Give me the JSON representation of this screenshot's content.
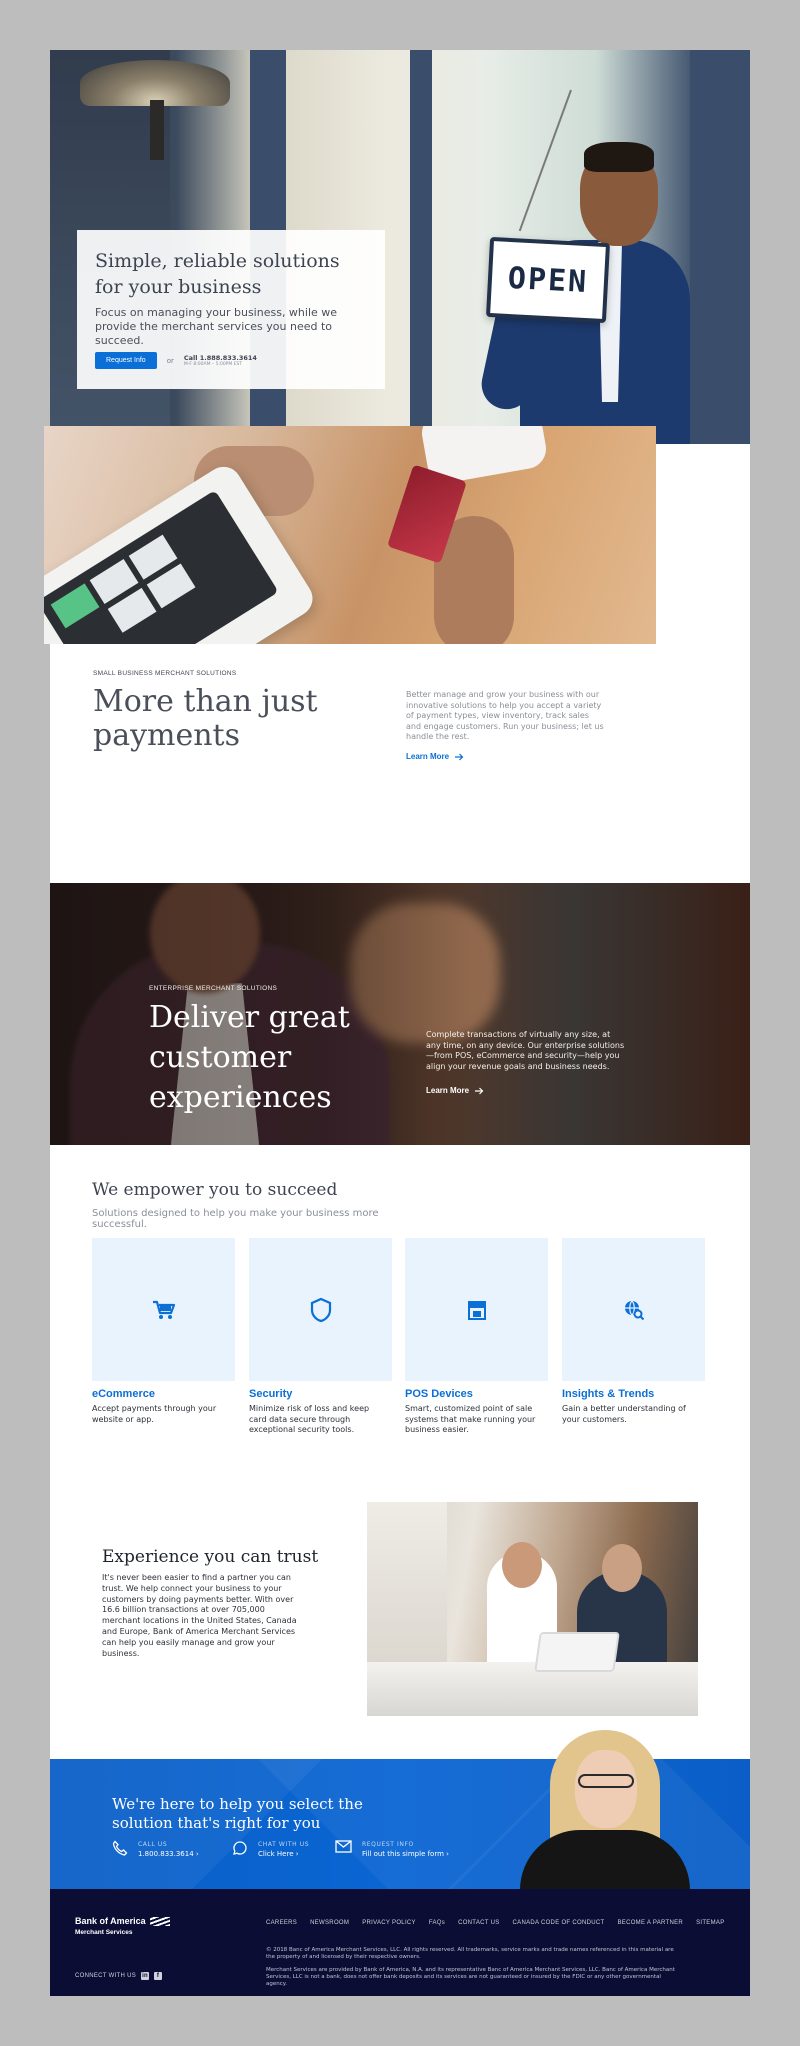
{
  "hero": {
    "title": "Simple, reliable solutions for your business",
    "text": "Focus on managing your business, while we provide the merchant services you need to succeed.",
    "button": "Request Info",
    "or": "or",
    "call": "Call 1.888.833.3614",
    "hours": "M-F 8:00AM – 5:00PM EST",
    "sign": "OPEN"
  },
  "payments": {
    "eyebrow": "SMALL BUSINESS MERCHANT SOLUTIONS",
    "title": "More than just payments",
    "text": "Better manage and grow your business with our innovative solutions to help you accept a variety of payment types, view inventory, track sales and engage customers. Run your business; let us handle the rest.",
    "link": "Learn More"
  },
  "enterprise": {
    "eyebrow": "ENTERPRISE MERCHANT SOLUTIONS",
    "title": "Deliver great customer experiences",
    "text": "Complete transactions of virtually any size, at any time, on any device. Our enterprise solutions—from POS, eCommerce and security—help you align your revenue goals and business needs.",
    "link": "Learn More"
  },
  "empower": {
    "title": "We empower you to succeed",
    "subtitle": "Solutions designed to help you make your business more successful.",
    "items": [
      {
        "title": "eCommerce",
        "text": "Accept payments through your website or app.",
        "icon": "cart-icon"
      },
      {
        "title": "Security",
        "text": "Minimize risk of loss and keep card data secure through exceptional security tools.",
        "icon": "shield-icon"
      },
      {
        "title": "POS Devices",
        "text": "Smart, customized point of sale systems that make running your business easier.",
        "icon": "store-icon"
      },
      {
        "title": "Insights & Trends",
        "text": "Gain a better understanding of your customers.",
        "icon": "globe-search-icon"
      }
    ]
  },
  "trust": {
    "title": "Experience you can trust",
    "text": "It's never been easier to find a partner you can trust. We help connect your business to your customers by doing payments better. With over 16.6 billion transactions at over 705,000 merchant locations in the United States, Canada and Europe, Bank of America Merchant Services can help you easily manage and grow your business."
  },
  "cta": {
    "title": "We're here to help you select the solution that's right for you",
    "call_label": "CALL US",
    "call_value": "1.800.833.3614",
    "chat_label": "CHAT WITH US",
    "chat_value": "Click Here",
    "info_label": "REQUEST INFO",
    "info_value": "Fill out this simple form"
  },
  "footer": {
    "logo": "Bank of America",
    "logo_sub": "Merchant Services",
    "nav": [
      "CAREERS",
      "NEWSROOM",
      "PRIVACY POLICY",
      "FAQs",
      "CONTACT US",
      "CANADA CODE OF CONDUCT",
      "BECOME A PARTNER",
      "SITEMAP"
    ],
    "legal1": "© 2018 Banc of America Merchant Services, LLC. All rights reserved. All trademarks, service marks and trade names referenced in this material are the property of and licensed by their respective owners.",
    "legal2": "Merchant Services are provided by Bank of America, N.A. and its representative Banc of America Merchant Services, LLC. Banc of America Merchant Services, LLC is not a bank, does not offer bank deposits and its services are not guaranteed or insured by the FDIC or any other governmental agency.",
    "connect": "CONNECT WITH US"
  },
  "colors": {
    "accent": "#0a6fd6",
    "footer_bg": "#0c0d34",
    "tile_bg": "#e8f3fd"
  }
}
